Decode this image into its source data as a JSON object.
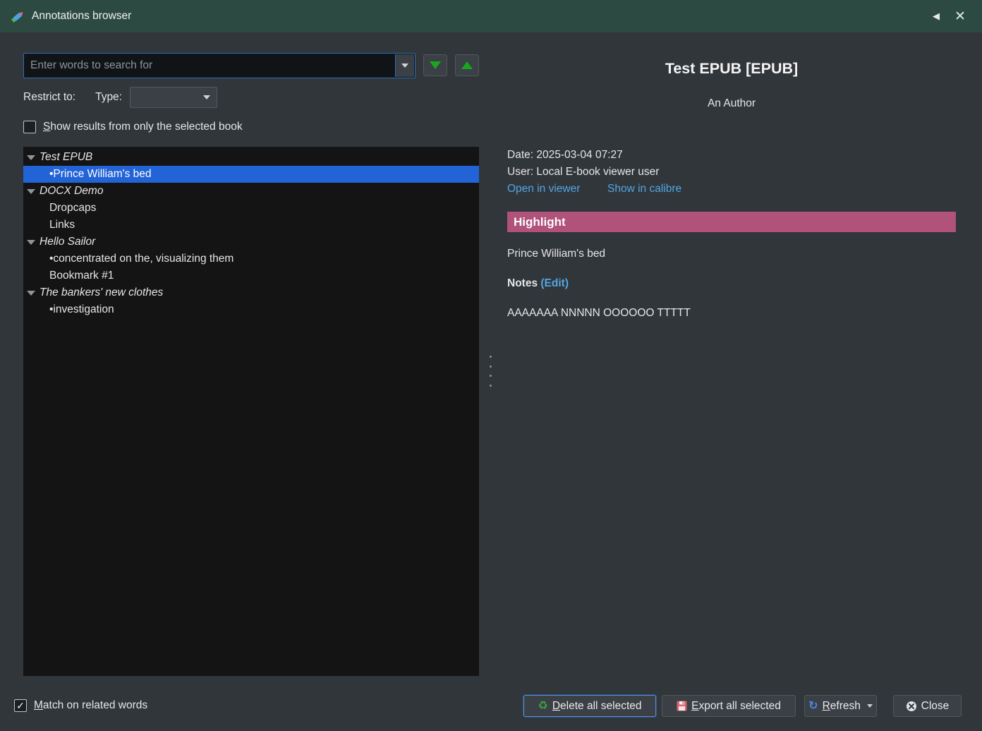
{
  "titlebar": {
    "title": "Annotations browser",
    "collapse_icon": "◀",
    "close_icon": "✕"
  },
  "search": {
    "placeholder": "Enter words to search for"
  },
  "filters": {
    "restrict_label": "Restrict to:",
    "type_label": "Type:",
    "type_value": ""
  },
  "options": {
    "only_selected_book": "Show results from only the selected book",
    "match_related": "Match on related words"
  },
  "icons": {
    "check": "✓",
    "recycle": "♻",
    "refresh": "↻"
  },
  "tree": {
    "items": [
      {
        "label": "Test EPUB",
        "kind": "book"
      },
      {
        "label": "•Prince William's bed",
        "kind": "entry",
        "selected": true
      },
      {
        "label": "DOCX Demo",
        "kind": "book"
      },
      {
        "label": "Dropcaps",
        "kind": "entry"
      },
      {
        "label": "Links",
        "kind": "entry"
      },
      {
        "label": "Hello Sailor",
        "kind": "book"
      },
      {
        "label": "•concentrated on the, visualizing them",
        "kind": "entry"
      },
      {
        "label": "Bookmark #1",
        "kind": "entry"
      },
      {
        "label": "The bankers' new clothes",
        "kind": "book"
      },
      {
        "label": "•investigation",
        "kind": "entry"
      }
    ]
  },
  "details": {
    "book_title": "Test EPUB [EPUB]",
    "author": "An Author",
    "date_line": "Date: 2025-03-04 07:27",
    "user_line": "User: Local E-book viewer user",
    "open_in_viewer": "Open in viewer",
    "show_in_calibre": "Show in calibre",
    "annotation_type": "Highlight",
    "highlight_text": "Prince William's bed",
    "notes_label": "Notes",
    "edit_link": "(Edit)",
    "notes_text": "AAAAAAA NNNNN OOOOOO TTTTT"
  },
  "actions": {
    "delete": "Delete all selected",
    "export": "Export all selected",
    "refresh": "Refresh",
    "close": "Close"
  },
  "colors": {
    "titlebar": "#2d4a42",
    "selection": "#2263d6",
    "highlight_banner": "#b0527a",
    "link": "#53a6e3",
    "tree_background": "#141414",
    "window_background": "#31363b"
  }
}
